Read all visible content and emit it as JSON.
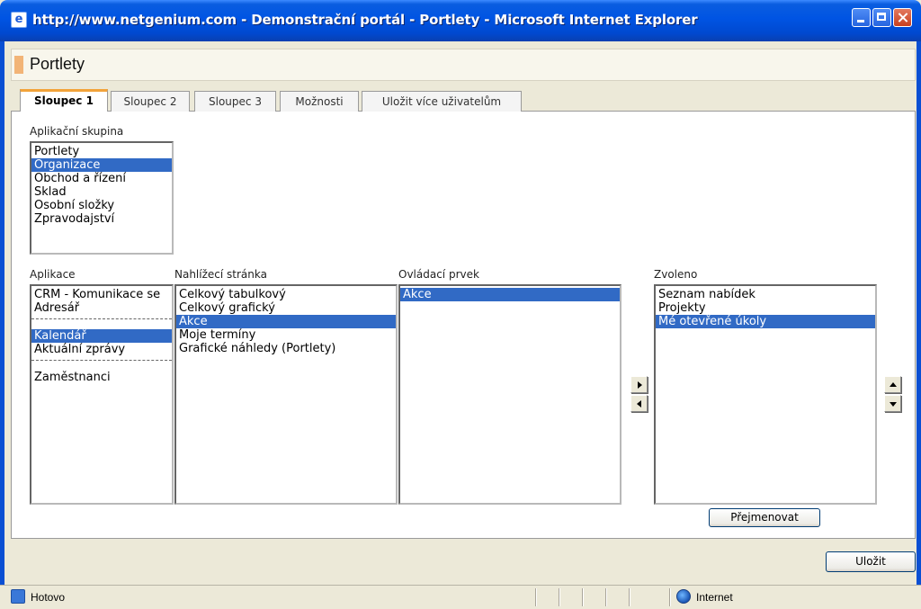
{
  "window": {
    "title": "http://www.netgenium.com - Demonstrační portál - Portlety - Microsoft Internet Explorer",
    "icon": "ie-page-icon"
  },
  "page": {
    "title": "Portlety"
  },
  "tabs": [
    {
      "label": "Sloupec 1",
      "active": true
    },
    {
      "label": "Sloupec 2",
      "active": false
    },
    {
      "label": "Sloupec 3",
      "active": false
    },
    {
      "label": "Možnosti",
      "active": false
    },
    {
      "label": "Uložit více uživatelům",
      "active": false
    }
  ],
  "app_group": {
    "label": "Aplikační skupina",
    "items": [
      "Portlety",
      "Organizace",
      "Obchod a řízení",
      "Sklad",
      "Osobní složky",
      "Zpravodajství"
    ],
    "selected": "Organizace"
  },
  "applications": {
    "label": "Aplikace",
    "items": [
      "CRM - Komunikace se",
      "Adresář",
      "Kalendář",
      "Aktuální zprávy",
      "Zaměstnanci"
    ],
    "selected": "Kalendář"
  },
  "view_page": {
    "label": "Nahlížecí stránka",
    "items": [
      "Celkový tabulkový",
      "Celkový grafický",
      "Akce",
      "Moje termíny",
      "Grafické náhledy (Portlety)"
    ],
    "selected": "Akce"
  },
  "control": {
    "label": "Ovládací prvek",
    "items": [
      "Akce"
    ],
    "selected": "Akce"
  },
  "selected_list": {
    "label": "Zvoleno",
    "items": [
      "Seznam nabídek",
      "Projekty",
      "Mé otevřené úkoly"
    ],
    "selected": "Mé otevřené úkoly"
  },
  "buttons": {
    "rename": "Přejmenovat",
    "save": "Uložit"
  },
  "status": {
    "text": "Hotovo",
    "zone": "Internet"
  },
  "colors": {
    "titlebar": "#0054e3",
    "selection": "#316ac5",
    "tab_accent": "#f2a33a"
  }
}
